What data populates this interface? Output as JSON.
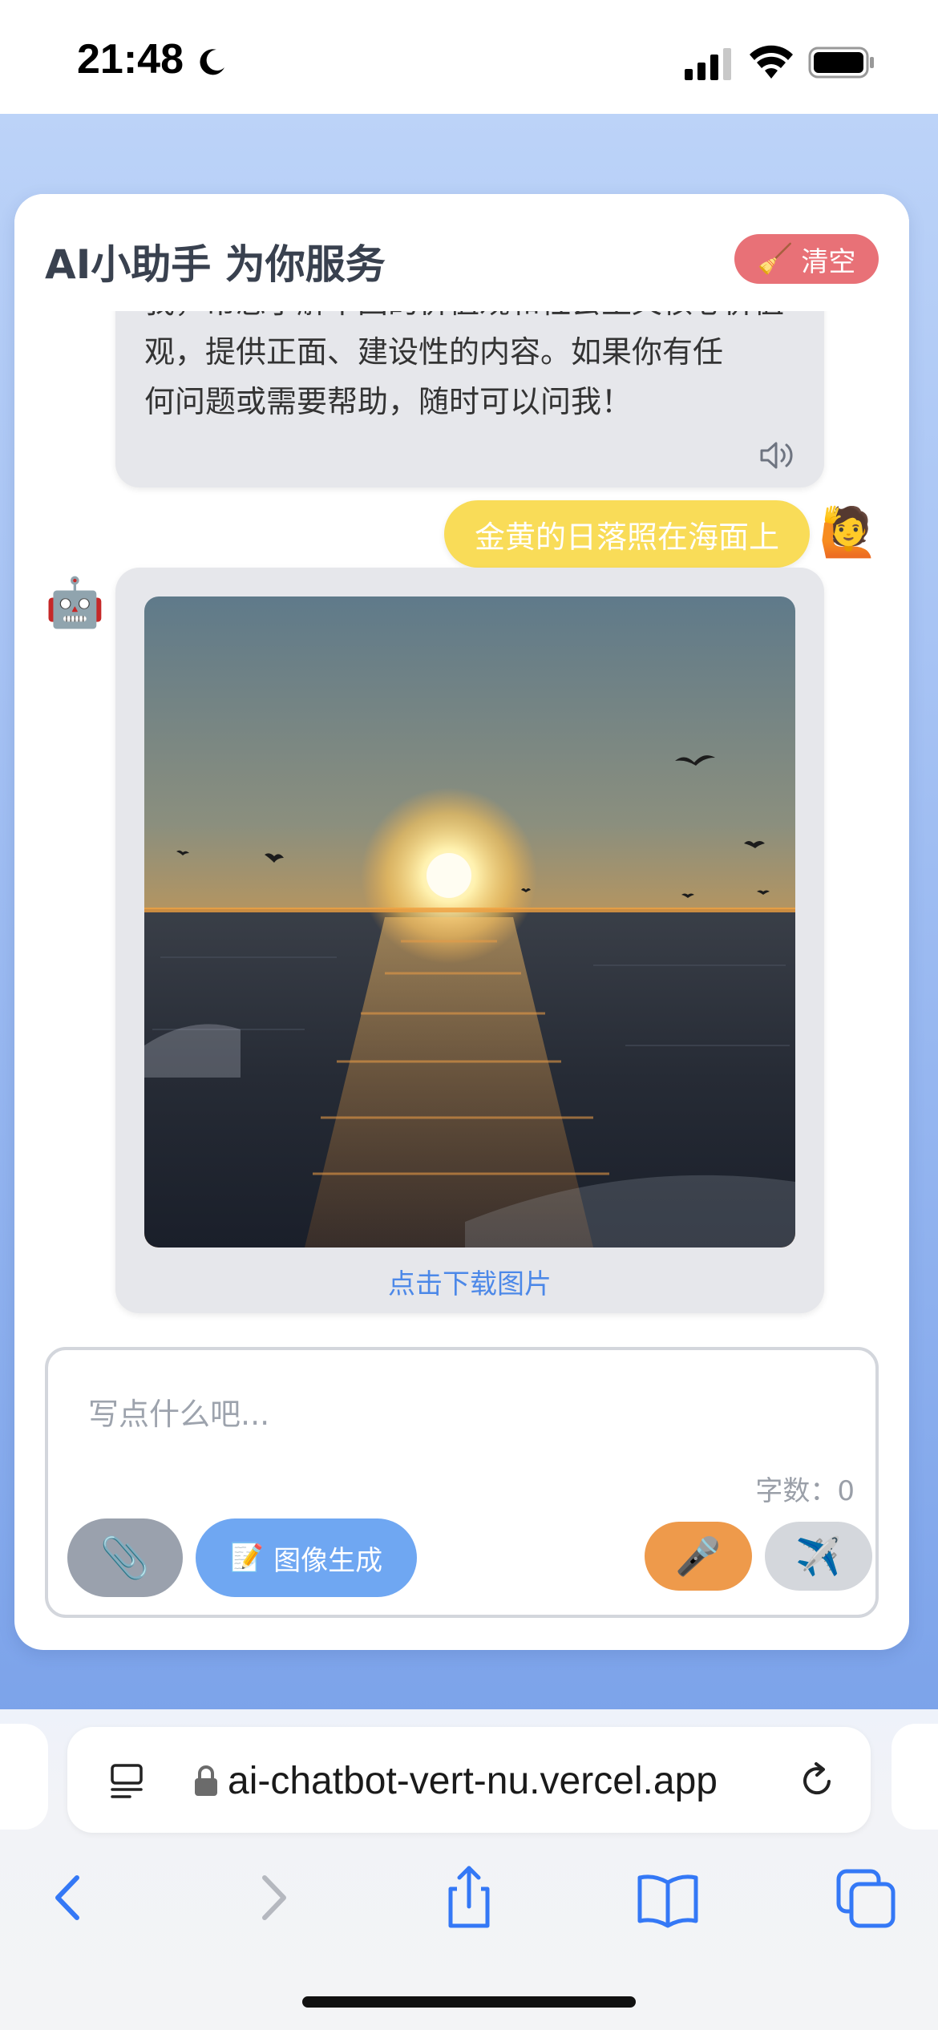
{
  "status_bar": {
    "time": "21:48",
    "icons": [
      "moon-icon",
      "signal-icon",
      "wifi-icon",
      "battery-icon"
    ]
  },
  "header": {
    "title": "AI小助手 为你服务",
    "clear_icon": "🧹",
    "clear_label": "清空"
  },
  "messages": {
    "bot_text_lines": [
      "我，帮您了解中国的价值观和社会主义核心价值",
      "观，提供正面、建设性的内容。如果你有任",
      "何问题或需要帮助，随时可以问我！"
    ],
    "user_prompt": "金黄的日落照在海面上",
    "user_avatar": "🙋",
    "bot_avatar": "🤖",
    "download_label": "点击下载图片"
  },
  "input": {
    "placeholder": "写点什么吧...",
    "value": "",
    "word_count_label": "字数：",
    "word_count": "0",
    "attach_icon": "📎",
    "image_gen_icon": "📝",
    "image_gen_label": "图像生成",
    "mic_icon": "🎤",
    "send_icon": "✈️"
  },
  "browser": {
    "url": "ai-chatbot-vert-nu.vercel.app"
  },
  "colors": {
    "page_gradient_top": "#bcd3f8",
    "page_gradient_bottom": "#7ca3ea",
    "clear_button": "#e87177",
    "user_bubble": "#f9dc58",
    "bot_bubble": "#e6e7eb",
    "link": "#4c88e8",
    "image_gen_button": "#6fa7f2",
    "mic_button": "#ee9a4b",
    "send_button": "#d4d7dc",
    "attach_button": "#9aa1ad",
    "browser_icon": "#3478f6"
  }
}
